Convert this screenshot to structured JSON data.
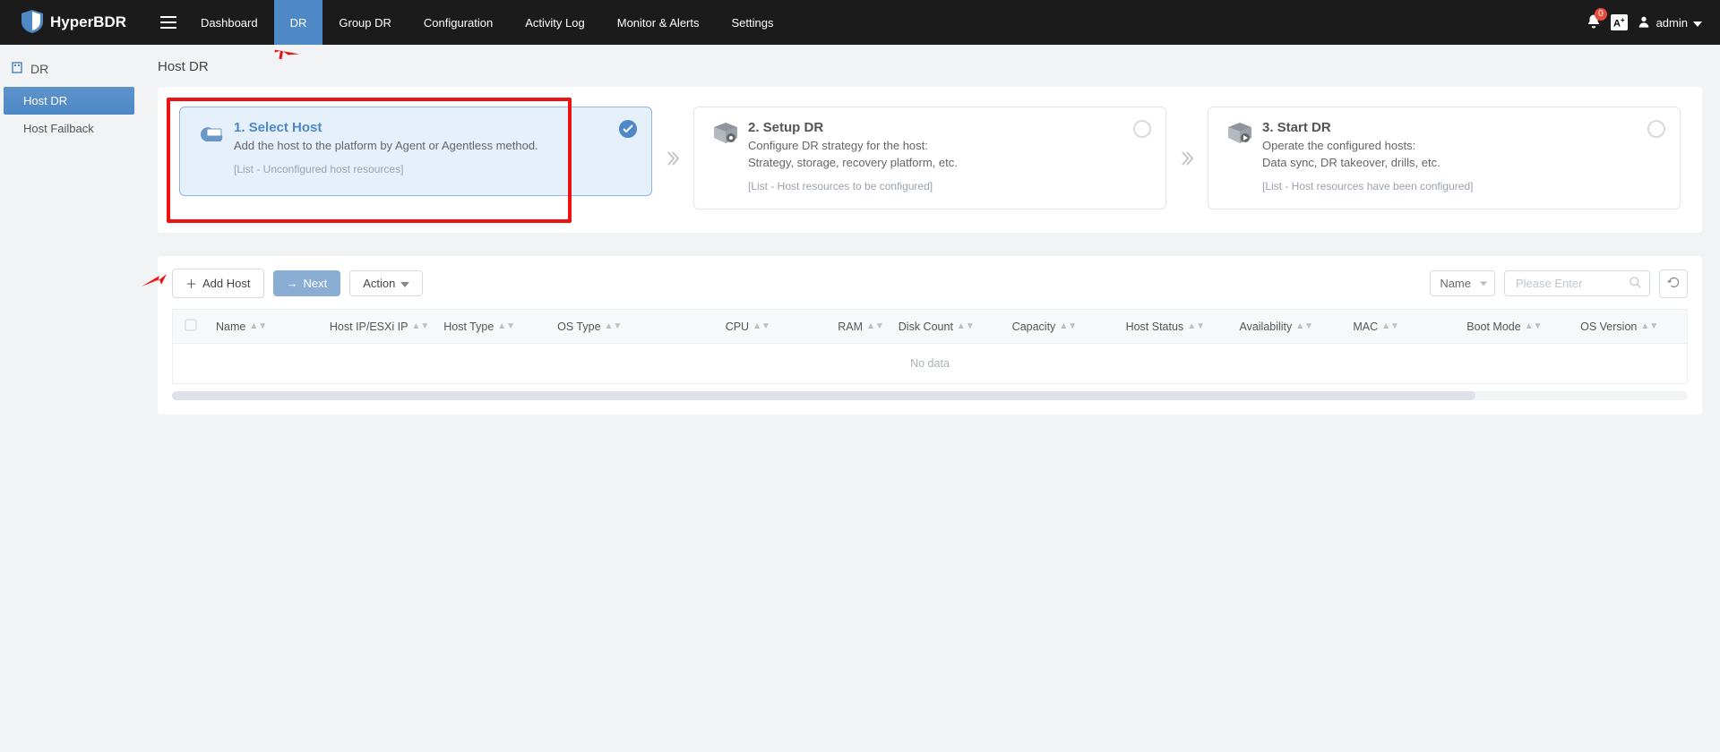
{
  "brand": "HyperBDR",
  "nav": [
    "Dashboard",
    "DR",
    "Group DR",
    "Configuration",
    "Activity Log",
    "Monitor & Alerts",
    "Settings"
  ],
  "nav_active_index": 1,
  "header": {
    "notif_count": "0",
    "lang": "A",
    "user": "admin"
  },
  "sidebar": {
    "section": "DR",
    "items": [
      "Host DR",
      "Host Failback"
    ],
    "active_index": 0
  },
  "page": {
    "title": "Host DR"
  },
  "steps": [
    {
      "title": "1. Select Host",
      "desc": "Add the host to the platform by Agent or Agentless method.",
      "list": "[List - Unconfigured host resources]"
    },
    {
      "title": "2. Setup DR",
      "desc": "Configure DR strategy for the host:",
      "desc2": "Strategy, storage, recovery platform, etc.",
      "list": "[List - Host resources to be configured]"
    },
    {
      "title": "3. Start DR",
      "desc": "Operate the configured hosts:",
      "desc2": "Data sync, DR takeover, drills, etc.",
      "list": "[List - Host resources have been configured]"
    }
  ],
  "toolbar": {
    "add_host_label": "Add Host",
    "next_label": "Next",
    "action_label": "Action",
    "filter_field": "Name",
    "search_placeholder": "Please Enter"
  },
  "table": {
    "columns": [
      "Name",
      "Host IP/ESXi IP",
      "Host Type",
      "OS Type",
      "CPU",
      "RAM",
      "Disk Count",
      "Capacity",
      "Host Status",
      "Availability",
      "MAC",
      "Boot Mode",
      "OS Version"
    ],
    "empty_text": "No data"
  }
}
